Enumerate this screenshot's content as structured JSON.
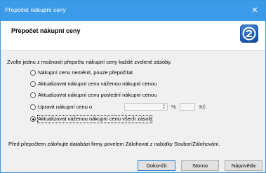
{
  "window": {
    "title": "Přepočet nákupní ceny",
    "close_glyph": "✕"
  },
  "header": {
    "title": "Přepočet nákupní ceny",
    "logo_icon": "app-logo-icon"
  },
  "intro_text": "Zvolte jednu z možností přepočtu nákupní ceny každé zvolené zásoby.",
  "options": [
    {
      "label": "Nákupní cenu neměnit, pouze přepočítat",
      "selected": false
    },
    {
      "label": "Aktualizovat nákupní cenu váženou nákupní cenou",
      "selected": false
    },
    {
      "label": "Aktualizovat nákupní cenu poslední nákupní cenou",
      "selected": false
    },
    {
      "label": "Upravit nákupní cenu o",
      "selected": false
    },
    {
      "label": "Aktualizovat váženou nákupní cenu všech zásob",
      "selected": true
    }
  ],
  "adjust": {
    "percent_value": "",
    "percent_unit": "%",
    "amount_value": "",
    "currency_unit": "Kč"
  },
  "footer_text": "Před přepočtem zálohujte databázi firmy povelem Zálohovat z nabídky Soubor/Zálohování.",
  "buttons": {
    "ok": "Dokončit",
    "cancel": "Storno",
    "help": "Nápověda"
  },
  "colors": {
    "titlebar": "#3c9be8",
    "default_button_border": "#2d7fd3"
  }
}
